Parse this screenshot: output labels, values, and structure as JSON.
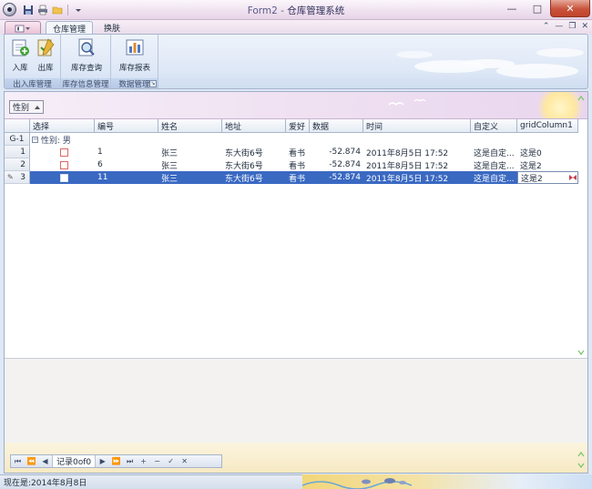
{
  "window": {
    "title_app": "Form2",
    "title_sep": " - ",
    "title_main": "仓库管理系统"
  },
  "ribbon": {
    "tabs": [
      {
        "label": "仓库管理",
        "active": true
      },
      {
        "label": "换肤",
        "active": false
      }
    ],
    "groups": [
      {
        "label": "出入库管理",
        "buttons": [
          "入库",
          "出库"
        ]
      },
      {
        "label": "库存信息管理",
        "buttons": [
          "库存查询"
        ]
      },
      {
        "label": "数据管理",
        "buttons": [
          "库存报表"
        ]
      }
    ]
  },
  "groupby": {
    "field": "性别"
  },
  "grid": {
    "columns": [
      "选择",
      "编号",
      "姓名",
      "地址",
      "爱好",
      "数据",
      "时间",
      "自定义",
      "gridColumn1"
    ],
    "group_row": {
      "indicator": "G-1",
      "text": "性别: 男"
    },
    "rows": [
      {
        "index": "1",
        "id": "1",
        "name": "张三",
        "address": "东大街6号",
        "hobby": "看书",
        "data": "-52.874",
        "time": "2011年8月5日 17:52",
        "custom": "这是自定...",
        "col1": "这是0",
        "selected": false
      },
      {
        "index": "2",
        "id": "6",
        "name": "张三",
        "address": "东大街6号",
        "hobby": "看书",
        "data": "-52.874",
        "time": "2011年8月5日 17:52",
        "custom": "这是自定...",
        "col1": "这是2",
        "selected": false
      },
      {
        "index": "3",
        "id": "11",
        "name": "张三",
        "address": "东大街6号",
        "hobby": "看书",
        "data": "-52.874",
        "time": "2011年8月5日 17:52",
        "custom": "这是自定...",
        "col1": "这是2",
        "selected": true
      }
    ]
  },
  "navigator": {
    "record_text": "记录0of0"
  },
  "status": {
    "text": "现在是:2014年8月8日"
  }
}
